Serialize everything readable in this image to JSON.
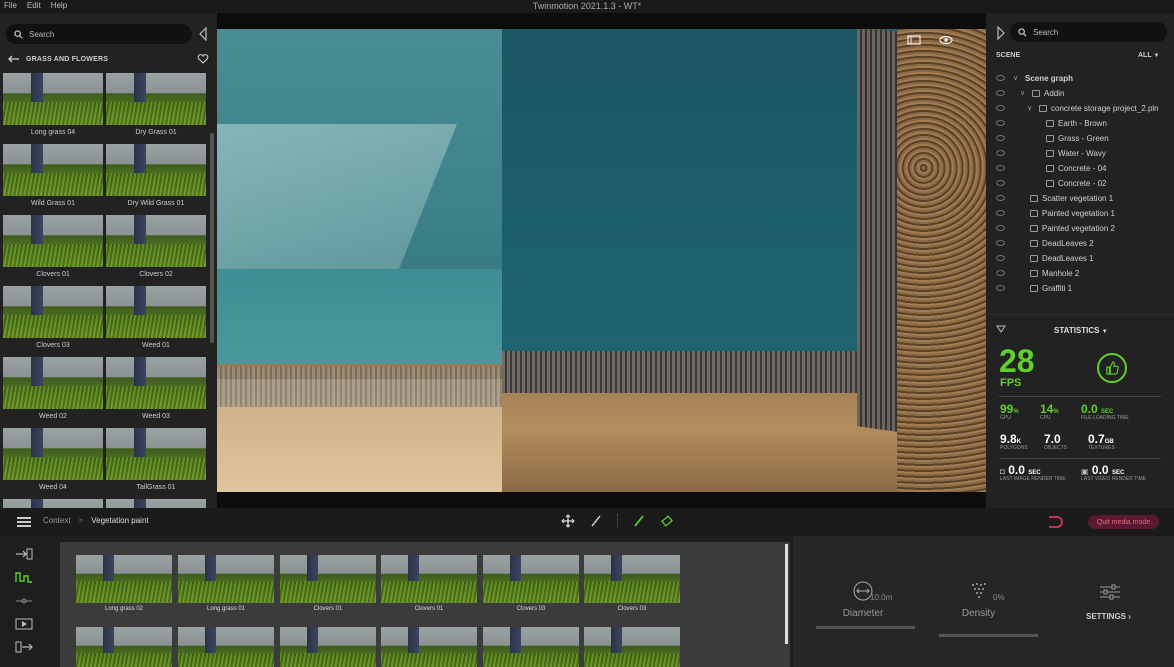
{
  "window": {
    "title": "Twinmotion 2021.1.3 - WT*",
    "menu": [
      "File",
      "Edit",
      "Help"
    ]
  },
  "library": {
    "search_placeholder": "Search",
    "header": "GRASS AND FLOWERS",
    "items": [
      "Long grass 04",
      "Dry Grass 01",
      "Wild Grass 01",
      "Dry Wild Grass 01",
      "Clovers 01",
      "Clovers 02",
      "Clovers 03",
      "Weed 01",
      "Weed 02",
      "Weed 03",
      "Weed 04",
      "TallGrass 01"
    ]
  },
  "scene": {
    "search_placeholder": "Search",
    "label": "SCENE",
    "filter": "ALL",
    "tree": [
      {
        "label": "Scene graph",
        "level": 0,
        "type": "root",
        "expanded": true
      },
      {
        "label": "Addin",
        "level": 1,
        "type": "folder",
        "expanded": true
      },
      {
        "label": "concrete storage project_2.pln",
        "level": 2,
        "type": "folder",
        "expanded": true
      },
      {
        "label": "Earth - Brown",
        "level": 3,
        "type": "material"
      },
      {
        "label": "Grass - Green",
        "level": 3,
        "type": "material"
      },
      {
        "label": "Water - Wavy",
        "level": 3,
        "type": "material"
      },
      {
        "label": "Concrete - 04",
        "level": 3,
        "type": "material"
      },
      {
        "label": "Concrete - 02",
        "level": 3,
        "type": "material"
      },
      {
        "label": "Scatter vegetation 1",
        "level": 1,
        "type": "vegetation"
      },
      {
        "label": "Painted vegetation 1",
        "level": 1,
        "type": "vegetation"
      },
      {
        "label": "Painted vegetation 2",
        "level": 1,
        "type": "vegetation"
      },
      {
        "label": "DeadLeaves 2",
        "level": 1,
        "type": "vegetation"
      },
      {
        "label": "DeadLeaves 1",
        "level": 1,
        "type": "vegetation"
      },
      {
        "label": "Manhole 2",
        "level": 1,
        "type": "object"
      },
      {
        "label": "Graffiti 1",
        "level": 1,
        "type": "object"
      }
    ]
  },
  "statistics": {
    "title": "STATISTICS",
    "fps": "28",
    "fps_unit": "FPS",
    "gpu": {
      "value": "99",
      "unit": "%",
      "caption": "GPU"
    },
    "cpu": {
      "value": "14",
      "unit": "%",
      "caption": "CPU"
    },
    "file_loading": {
      "value": "0.0",
      "unit": "SEC",
      "caption": "FILE LOADING TIME"
    },
    "polygons": {
      "value": "9.8",
      "unit": "K",
      "caption": "POLYGONS"
    },
    "objects": {
      "value": "7.0",
      "unit": "",
      "caption": "OBJECTS"
    },
    "textures": {
      "value": "0.7",
      "unit": "GB",
      "caption": "TEXTURES"
    },
    "image_render": {
      "value": "0.0",
      "unit": "SEC",
      "caption": "LAST IMAGE RENDER TIME"
    },
    "video_render": {
      "value": "0.0",
      "unit": "SEC",
      "caption": "LAST VIDEO RENDER TIME"
    }
  },
  "toolbar": {
    "context": "Context",
    "separator": ">",
    "current": "Vegetation paint",
    "quit_label": "Quit media mode"
  },
  "palette": {
    "items": [
      "Long grass 02",
      "Long grass 01",
      "Clovers 01",
      "Clovers 01",
      "Clovers 03",
      "Clovers 03"
    ]
  },
  "params": {
    "diameter_label": "Diameter",
    "diameter_value": "10.0m",
    "density_label": "Density",
    "density_value": "0%",
    "settings_label": "SETTINGS"
  },
  "colors": {
    "accent_green": "#5fcf2b",
    "quit_button": "#5b1830",
    "undo": "#c0354f"
  }
}
